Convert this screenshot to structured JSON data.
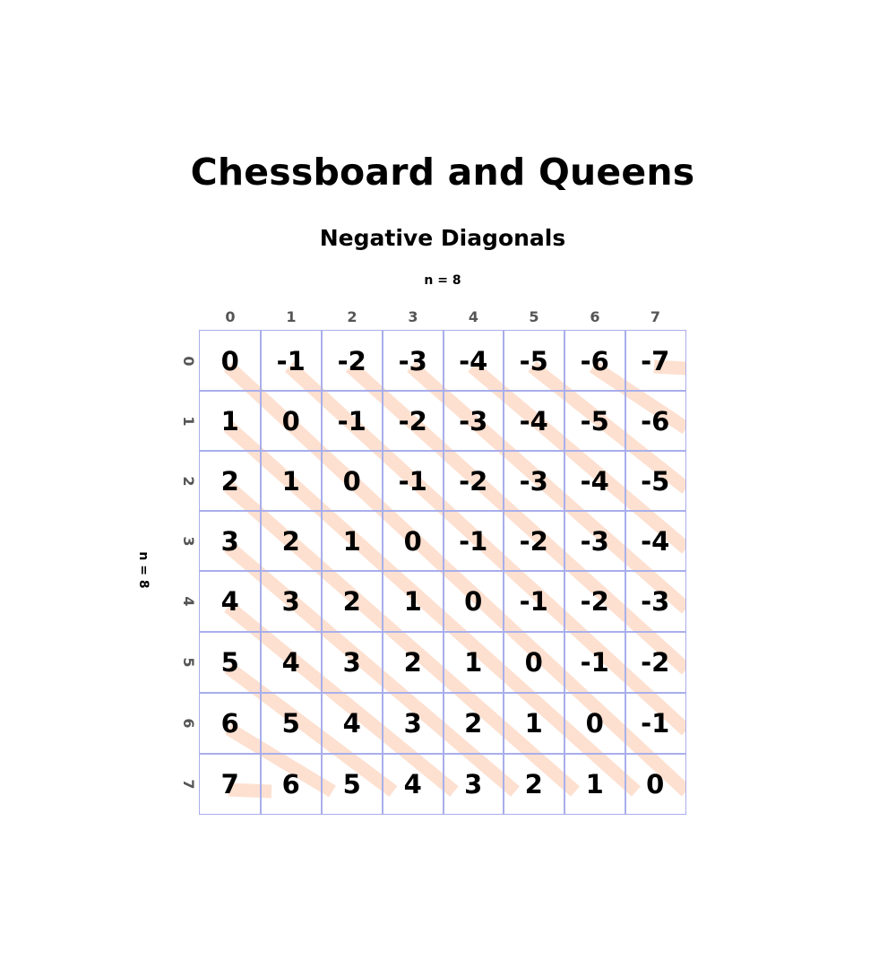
{
  "title": "Chessboard and Queens",
  "subtitle": "Negative Diagonals",
  "n_label_top": "n = 8",
  "n_label_side": "n = 8",
  "col_indices": [
    "0",
    "1",
    "2",
    "3",
    "4",
    "5",
    "6",
    "7"
  ],
  "row_indices": [
    "0",
    "1",
    "2",
    "3",
    "4",
    "5",
    "6",
    "7"
  ],
  "grid": [
    [
      "0",
      "-1",
      "-2",
      "-3",
      "-4",
      "-5",
      "-6",
      "-7"
    ],
    [
      "1",
      "0",
      "-1",
      "-2",
      "-3",
      "-4",
      "-5",
      "-6"
    ],
    [
      "2",
      "1",
      "0",
      "-1",
      "-2",
      "-3",
      "-4",
      "-5"
    ],
    [
      "3",
      "2",
      "1",
      "0",
      "-1",
      "-2",
      "-3",
      "-4"
    ],
    [
      "4",
      "3",
      "2",
      "1",
      "0",
      "-1",
      "-2",
      "-3"
    ],
    [
      "5",
      "4",
      "3",
      "2",
      "1",
      "0",
      "-1",
      "-2"
    ],
    [
      "6",
      "5",
      "4",
      "3",
      "2",
      "1",
      "0",
      "-1"
    ],
    [
      "7",
      "6",
      "5",
      "4",
      "3",
      "2",
      "1",
      "0"
    ]
  ],
  "colors": {
    "grid_line": "#a9aeeb",
    "diagonal_band": "#fde0d0",
    "index_text": "#555555",
    "cell_text": "#000000"
  }
}
